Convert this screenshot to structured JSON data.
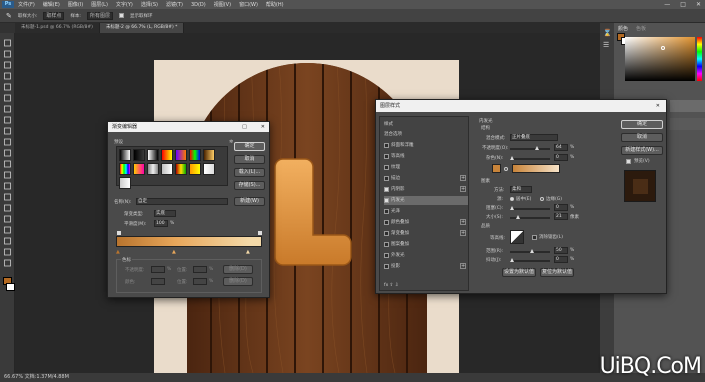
{
  "app": {
    "logo": "Ps"
  },
  "menubar": {
    "items": [
      "文件(F)",
      "编辑(E)",
      "图像(I)",
      "图层(L)",
      "文字(Y)",
      "选择(S)",
      "滤镜(T)",
      "3D(D)",
      "视图(V)",
      "窗口(W)",
      "帮助(H)"
    ]
  },
  "optbar": {
    "tool_size": "取样大小:",
    "size_value": "取样点",
    "sample_label": "样本:",
    "sample_value": "所有图层",
    "ring_label": "显示取样环"
  },
  "tabs": [
    {
      "label": "未标题-1.psd @ 66.7% (RGB/8#)",
      "active": false
    },
    {
      "label": "未标题-2 @ 66.7% (L, RGB/8#) *",
      "active": true
    }
  ],
  "status": {
    "text": "66.67%    文档:1.37M/4.88M"
  },
  "color_panel": {
    "tab1": "颜色",
    "tab2": "色板"
  },
  "gradient_editor": {
    "title": "渐变编辑器",
    "presets_label": "预设",
    "ok": "确定",
    "cancel": "取消",
    "load": "载入(L)...",
    "save": "存储(S)...",
    "name_label": "名称(N):",
    "name_value": "自定",
    "new": "新建(W)",
    "type_label": "渐变类型:",
    "type_value": "实底",
    "smooth_label": "平滑度(M):",
    "smooth_value": "100",
    "smooth_unit": "%",
    "stops_label": "色标",
    "opacity_label": "不透明度:",
    "opacity_unit": "%",
    "location_label": "位置:",
    "location_unit": "%",
    "delete_label": "删除(D)",
    "color_label": "颜色:",
    "colors": {
      "dark": "#b8742e",
      "light": "#f3d9a8",
      "mid": "#e7a65a"
    }
  },
  "layer_style": {
    "title": "图层样式",
    "styles_header": "样式",
    "blend_header": "混合选项",
    "items": [
      {
        "label": "斜面和浮雕",
        "checked": false,
        "plus": false,
        "selected": false
      },
      {
        "label": "等高线",
        "checked": false,
        "plus": false,
        "selected": false
      },
      {
        "label": "纹理",
        "checked": false,
        "plus": false,
        "selected": false
      },
      {
        "label": "描边",
        "checked": false,
        "plus": true,
        "selected": false
      },
      {
        "label": "内阴影",
        "checked": true,
        "plus": true,
        "selected": false
      },
      {
        "label": "内发光",
        "checked": true,
        "plus": false,
        "selected": true
      },
      {
        "label": "光泽",
        "checked": false,
        "plus": false,
        "selected": false
      },
      {
        "label": "颜色叠加",
        "checked": false,
        "plus": true,
        "selected": false
      },
      {
        "label": "渐变叠加",
        "checked": false,
        "plus": true,
        "selected": false
      },
      {
        "label": "图案叠加",
        "checked": false,
        "plus": false,
        "selected": false
      },
      {
        "label": "外发光",
        "checked": false,
        "plus": false,
        "selected": false
      },
      {
        "label": "投影",
        "checked": false,
        "plus": true,
        "selected": false
      }
    ],
    "footer": "fx  ⇧  ⇩",
    "section_title": "内发光",
    "structure": "结构",
    "blend_mode_label": "混合模式:",
    "blend_mode_value": "正片叠底",
    "opacity_label": "不透明度(O):",
    "opacity_value": "64",
    "noise_label": "杂色(N):",
    "noise_value": "0",
    "pct": "%",
    "elements": "图素",
    "method_label": "方法:",
    "method_value": "柔和",
    "source_label": "源:",
    "source_center": "居中(E)",
    "source_edge": "边缘(G)",
    "choke_label": "阻塞(C):",
    "choke_value": "0",
    "size_label": "大小(S):",
    "size_value": "21",
    "px": "像素",
    "quality": "品质",
    "contour_label": "等高线:",
    "antialias": "消除锯齿(L)",
    "range_label": "范围(R):",
    "range_value": "50",
    "jitter_label": "抖动(J):",
    "jitter_value": "0",
    "default_set": "设置为默认值",
    "default_reset": "复位为默认值",
    "ok": "确定",
    "cancel": "取消",
    "new_style": "新建样式(W)...",
    "preview": "预览(V)",
    "glow_color": "#c8843a"
  },
  "watermark": "UiBQ.CoM"
}
